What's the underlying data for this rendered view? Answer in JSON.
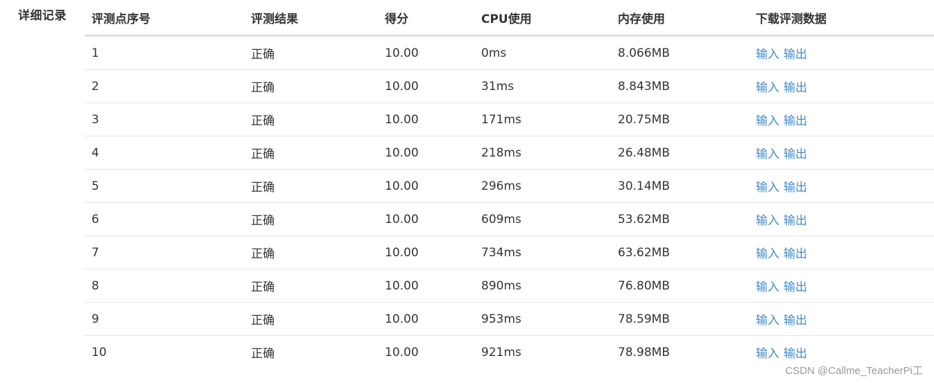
{
  "section": {
    "label": "详细记录"
  },
  "table": {
    "headers": [
      "评测点序号",
      "评测结果",
      "得分",
      "CPU使用",
      "内存使用",
      "下载评测数据"
    ],
    "rows": [
      {
        "index": "1",
        "result": "正确",
        "score": "10.00",
        "cpu": "0ms",
        "memory": "8.066MB",
        "input_label": "输入",
        "output_label": "输出"
      },
      {
        "index": "2",
        "result": "正确",
        "score": "10.00",
        "cpu": "31ms",
        "memory": "8.843MB",
        "input_label": "输入",
        "output_label": "输出"
      },
      {
        "index": "3",
        "result": "正确",
        "score": "10.00",
        "cpu": "171ms",
        "memory": "20.75MB",
        "input_label": "输入",
        "output_label": "输出"
      },
      {
        "index": "4",
        "result": "正确",
        "score": "10.00",
        "cpu": "218ms",
        "memory": "26.48MB",
        "input_label": "输入",
        "output_label": "输出"
      },
      {
        "index": "5",
        "result": "正确",
        "score": "10.00",
        "cpu": "296ms",
        "memory": "30.14MB",
        "input_label": "输入",
        "output_label": "输出"
      },
      {
        "index": "6",
        "result": "正确",
        "score": "10.00",
        "cpu": "609ms",
        "memory": "53.62MB",
        "input_label": "输入",
        "output_label": "输出"
      },
      {
        "index": "7",
        "result": "正确",
        "score": "10.00",
        "cpu": "734ms",
        "memory": "63.62MB",
        "input_label": "输入",
        "output_label": "输出"
      },
      {
        "index": "8",
        "result": "正确",
        "score": "10.00",
        "cpu": "890ms",
        "memory": "76.80MB",
        "input_label": "输入",
        "output_label": "输出"
      },
      {
        "index": "9",
        "result": "正确",
        "score": "10.00",
        "cpu": "953ms",
        "memory": "78.59MB",
        "input_label": "输入",
        "output_label": "输出"
      },
      {
        "index": "10",
        "result": "正确",
        "score": "10.00",
        "cpu": "921ms",
        "memory": "78.98MB",
        "input_label": "输入",
        "output_label": "输出"
      }
    ]
  },
  "watermark": "CSDN @Callme_TeacherPi工",
  "colors": {
    "link": "#428bca",
    "text": "#333333",
    "header_border": "#dfdfdf",
    "row_border": "#e5e5e5"
  }
}
